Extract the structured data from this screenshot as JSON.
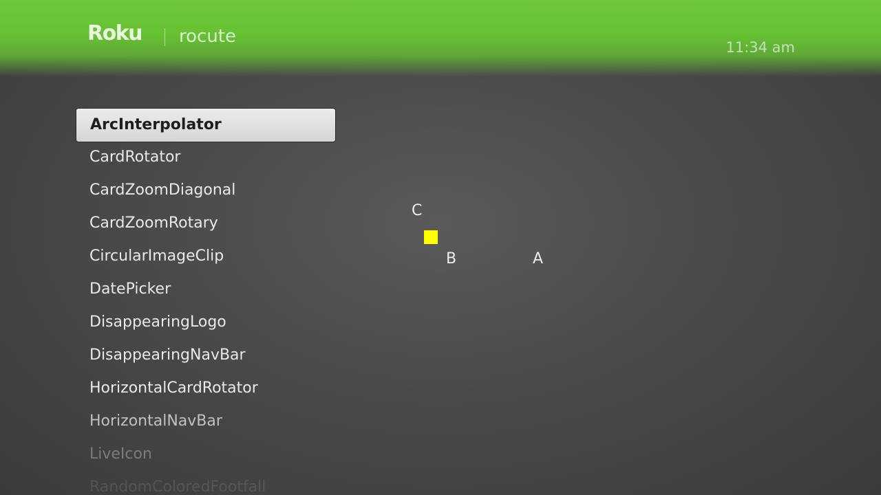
{
  "header": {
    "logo": "Roku",
    "app_name": "rocute",
    "time": "11:34  am",
    "accent_color": "#6ec73a"
  },
  "menu": {
    "items": [
      {
        "label": "ArcInterpolator",
        "state": "selected"
      },
      {
        "label": "CardRotator"
      },
      {
        "label": "CardZoomDiagonal"
      },
      {
        "label": "CardZoomRotary"
      },
      {
        "label": "CircularImageClip"
      },
      {
        "label": "DatePicker"
      },
      {
        "label": "DisappearingLogo"
      },
      {
        "label": "DisappearingNavBar"
      },
      {
        "label": "HorizontalCardRotator"
      },
      {
        "label": "HorizontalNavBar"
      },
      {
        "label": "LiveIcon"
      },
      {
        "label": "RandomColoredFootfall"
      }
    ]
  },
  "demo": {
    "point_labels": {
      "a": "A",
      "b": "B",
      "c": "C"
    },
    "marker_color": "#ffff00"
  }
}
